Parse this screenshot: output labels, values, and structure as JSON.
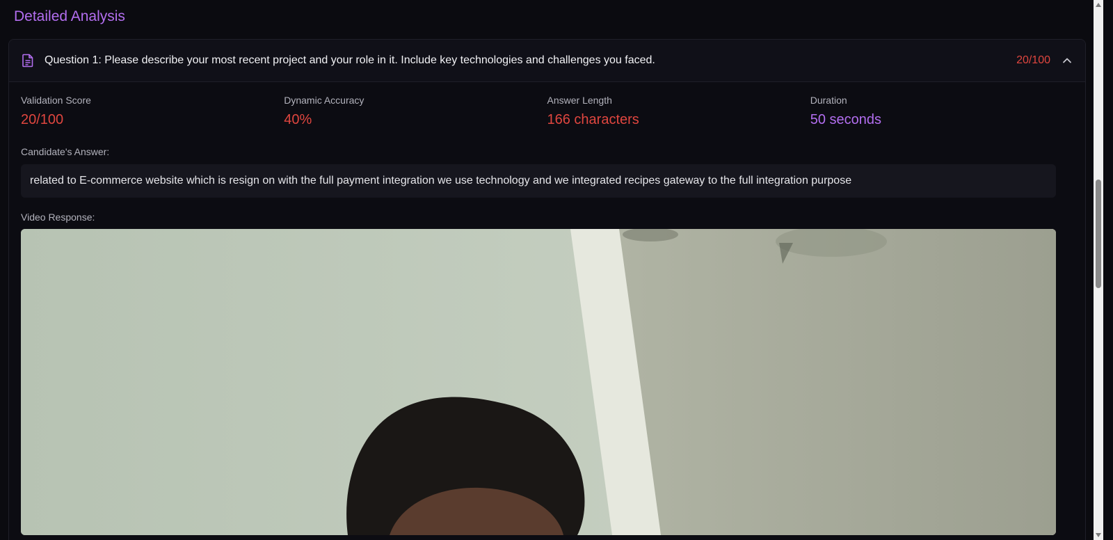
{
  "section": {
    "title": "Detailed Analysis"
  },
  "question": {
    "title": "Question 1: Please describe your most recent project and your role in it. Include key technologies and challenges you faced.",
    "score": "20/100"
  },
  "metrics": [
    {
      "label": "Validation Score",
      "value": "20/100",
      "color": "#e0463f"
    },
    {
      "label": "Dynamic Accuracy",
      "value": "40%",
      "color": "#e0463f"
    },
    {
      "label": "Answer Length",
      "value": "166 characters",
      "color": "#e0463f"
    },
    {
      "label": "Duration",
      "value": "50 seconds",
      "color": "#b36ef0"
    }
  ],
  "answer": {
    "label": "Candidate's Answer:",
    "text": "related to E-commerce website which is resign on with the full payment integration we use technology and we integrated recipes gateway to the full integration purpose"
  },
  "video": {
    "label": "Video Response:"
  },
  "icons": {
    "document": "document-icon",
    "chevron": "chevron-up-icon"
  },
  "colors": {
    "accent": "#b36ef0",
    "danger": "#e0463f",
    "background": "#0b0b10"
  }
}
